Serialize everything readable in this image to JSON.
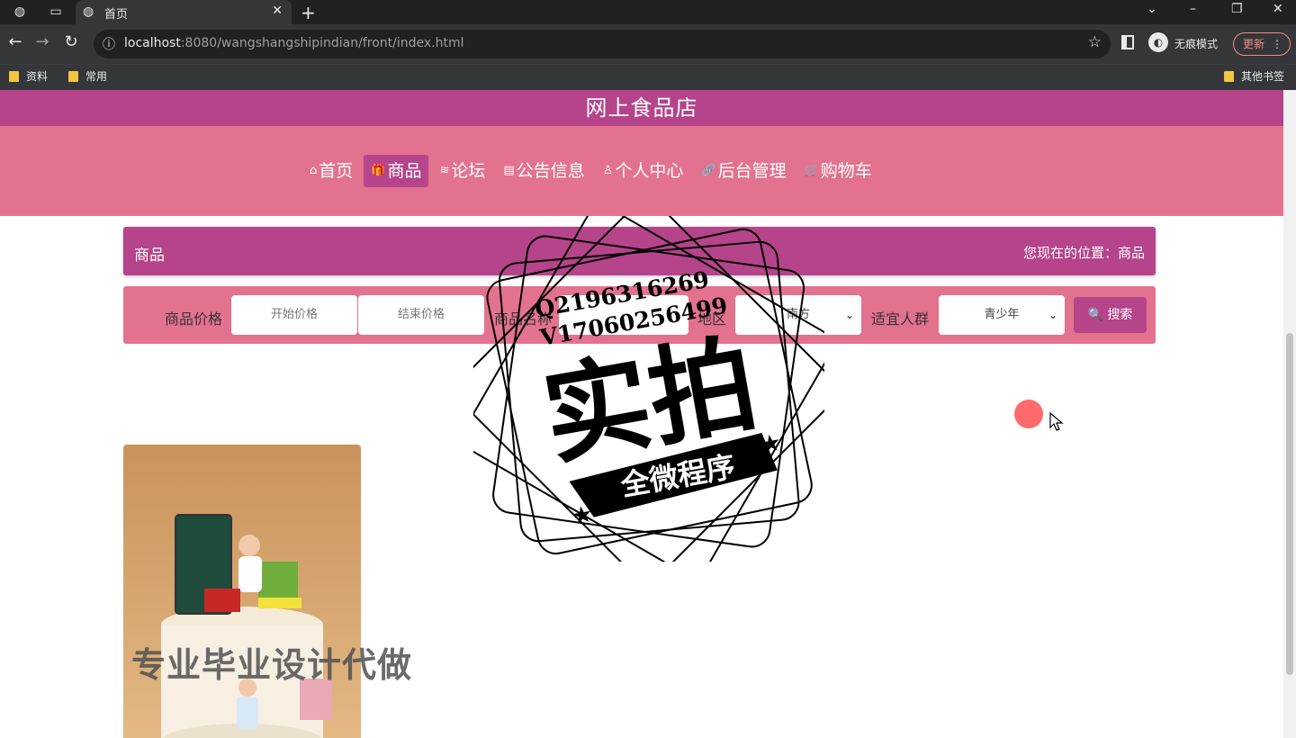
{
  "browser": {
    "tab_title": "首页",
    "url_host": "localhost",
    "url_rest": ":8080/wangshangshipindian/front/index.html",
    "incognito_label": "无痕模式",
    "update_label": "更新",
    "bookmarks": [
      "资料",
      "常用"
    ],
    "other_bookmarks": "其他书签"
  },
  "site": {
    "title": "网上食品店",
    "nav": [
      {
        "label": "首页",
        "icon": "home-icon",
        "glyph": "⌂"
      },
      {
        "label": "商品",
        "icon": "gift-icon",
        "glyph": "🎁"
      },
      {
        "label": "论坛",
        "icon": "layers-icon",
        "glyph": "≋"
      },
      {
        "label": "公告信息",
        "icon": "notice-icon",
        "glyph": "▤"
      },
      {
        "label": "个人中心",
        "icon": "user-icon",
        "glyph": "♙"
      },
      {
        "label": "后台管理",
        "icon": "link-icon",
        "glyph": "🔗"
      },
      {
        "label": "购物车",
        "icon": "cart-icon",
        "glyph": "🛒"
      }
    ]
  },
  "crumb": {
    "title": "商品",
    "location": "您现在的位置：商品"
  },
  "search": {
    "price_label": "商品价格",
    "price_start_placeholder": "开始价格",
    "price_end_placeholder": "结束价格",
    "name_label": "商品名称",
    "region_label": "地区",
    "region_value": "南方",
    "audience_label": "适宜人群",
    "audience_value": "青少年",
    "search_label": "搜索"
  },
  "watermark": {
    "line1": "Q2196316269",
    "line2": "V17060256499",
    "main": "实拍",
    "banner": "全微程序"
  },
  "overlay_text": "专业毕业设计代做",
  "colors": {
    "header": "#b5448a",
    "nav": "#e3728f"
  }
}
